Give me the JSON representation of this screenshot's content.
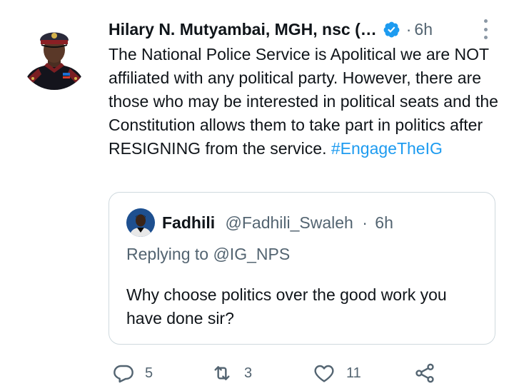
{
  "tweet": {
    "author_name": "Hilary N. Mutyambai, MGH, nsc (…",
    "separator": "·",
    "time": "6h",
    "text": "The National Police Service is Apolitical we are NOT affiliated with any political party. However, there are those who may be interested in political seats and the Constitution allows them to take part in politics after RESIGNING from the service.",
    "hashtag": "#EngageTheIG",
    "colors": {
      "accent": "#1d9bf0",
      "text": "#0f1419",
      "secondary": "#536471"
    }
  },
  "quoted_tweet": {
    "author_name": "Fadhili",
    "handle": "@Fadhili_Swaleh",
    "separator": "·",
    "time": "6h",
    "replying_to": "Replying to @IG_NPS",
    "text": "Why choose politics over the good work you have done sir?"
  },
  "actions": {
    "reply_count": "5",
    "retweet_count": "3",
    "like_count": "11",
    "icons": [
      "reply-icon",
      "retweet-icon",
      "like-icon",
      "share-icon"
    ]
  }
}
